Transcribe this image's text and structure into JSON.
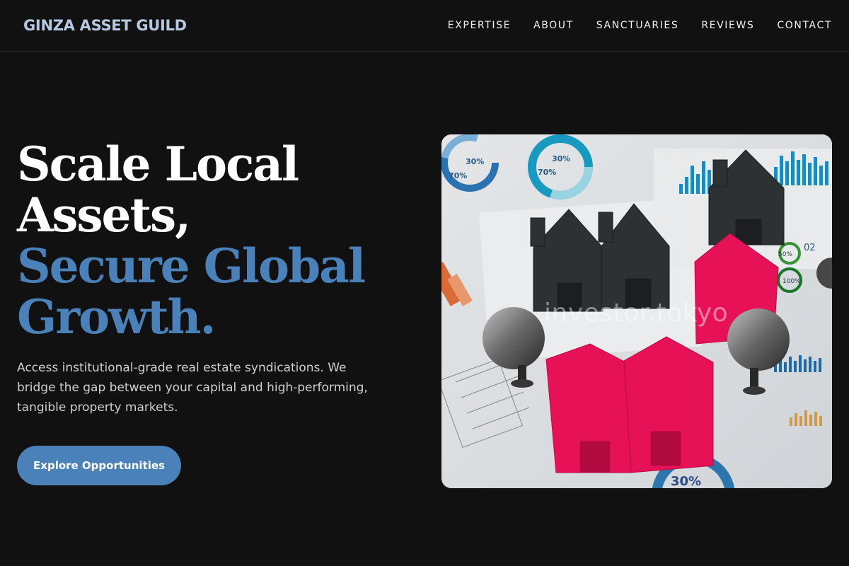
{
  "header": {
    "brand": "GINZA ASSET GUILD",
    "nav": [
      "EXPERTISE",
      "ABOUT",
      "SANCTUARIES",
      "REVIEWS",
      "CONTACT"
    ]
  },
  "hero": {
    "title_line1": "Scale Local",
    "title_line2": "Assets,",
    "title_line3": "Secure Global",
    "title_line4": "Growth.",
    "subtitle": "Access institutional-grade real estate syndications. We bridge the gap between your capital and high-performing, tangible property markets.",
    "cta_label": "Explore Opportunities",
    "image": {
      "watermark": "investor.tokyo",
      "chart_labels": [
        "30%",
        "70%",
        "30%",
        "70%",
        "50%",
        "02",
        "100%",
        "30%"
      ]
    }
  },
  "colors": {
    "background": "#111112",
    "accent": "#4a81b9",
    "brand": "#b6c9e2",
    "house_red": "#f0125a",
    "house_dark": "#2e3134"
  }
}
